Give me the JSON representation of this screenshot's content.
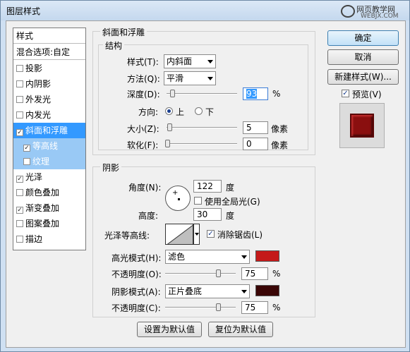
{
  "window": {
    "title": "图层样式"
  },
  "watermark": {
    "line1": "网页教学网",
    "line2": "WEBJX.COM"
  },
  "styles_panel": {
    "header": "样式",
    "blend_options": "混合选项:自定",
    "items": [
      {
        "label": "投影",
        "checked": false
      },
      {
        "label": "内阴影",
        "checked": false
      },
      {
        "label": "外发光",
        "checked": false
      },
      {
        "label": "内发光",
        "checked": false
      },
      {
        "label": "斜面和浮雕",
        "checked": true
      },
      {
        "label": "等高线",
        "checked": true
      },
      {
        "label": "纹理",
        "checked": false
      },
      {
        "label": "光泽",
        "checked": true
      },
      {
        "label": "颜色叠加",
        "checked": false
      },
      {
        "label": "渐变叠加",
        "checked": true
      },
      {
        "label": "图案叠加",
        "checked": false
      },
      {
        "label": "描边",
        "checked": false
      }
    ]
  },
  "bevel": {
    "group_title": "斜面和浮雕",
    "structure_title": "结构",
    "style_label": "样式(T):",
    "style_value": "内斜面",
    "technique_label": "方法(Q):",
    "technique_value": "平滑",
    "depth_label": "深度(D):",
    "depth_value": "93",
    "depth_unit": "%",
    "direction_label": "方向:",
    "direction_up": "上",
    "direction_down": "下",
    "size_label": "大小(Z):",
    "size_value": "5",
    "size_unit": "像素",
    "soften_label": "软化(F):",
    "soften_value": "0",
    "soften_unit": "像素"
  },
  "shading": {
    "title": "阴影",
    "angle_label": "角度(N):",
    "angle_value": "122",
    "angle_unit": "度",
    "global_light_label": "使用全局光(G)",
    "altitude_label": "高度:",
    "altitude_value": "30",
    "altitude_unit": "度",
    "gloss_contour_label": "光泽等高线:",
    "antialias_label": "消除锯齿(L)",
    "highlight_mode_label": "高光模式(H):",
    "highlight_mode_value": "滤色",
    "highlight_color": "#c41a1a",
    "highlight_opacity_label": "不透明度(O):",
    "highlight_opacity_value": "75",
    "shadow_mode_label": "阴影模式(A):",
    "shadow_mode_value": "正片叠底",
    "shadow_color": "#3a0606",
    "shadow_opacity_label": "不透明度(C):",
    "shadow_opacity_value": "75",
    "percent": "%"
  },
  "buttons": {
    "ok": "确定",
    "cancel": "取消",
    "new_style": "新建样式(W)...",
    "preview": "预览(V)",
    "make_default": "设置为默认值",
    "reset_default": "复位为默认值"
  },
  "preview_swatch_color": "#8a0f0f"
}
